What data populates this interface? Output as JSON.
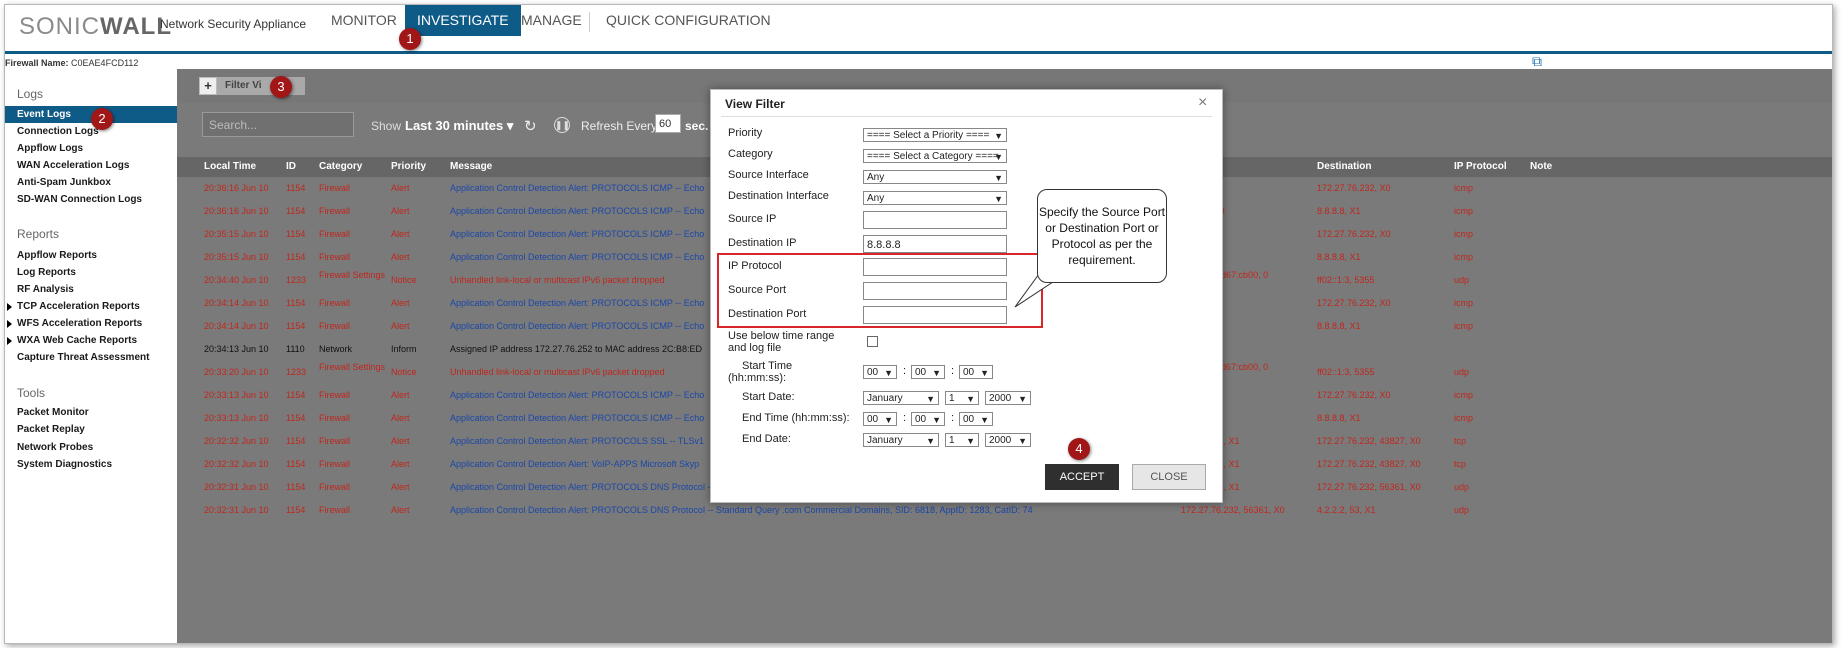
{
  "header": {
    "logo_light": "SONIC",
    "logo_bold": "WALL",
    "tagline": "Network Security Appliance",
    "tabs": [
      {
        "label": "MONITOR"
      },
      {
        "label": "INVESTIGATE"
      },
      {
        "label": "MANAGE"
      },
      {
        "label": "QUICK CONFIGURATION"
      }
    ],
    "firewall_label": "Firewall Name:",
    "firewall_value": "C0EAE4FCD112",
    "accent_color": "#0f5b87"
  },
  "sidebar": {
    "sections": [
      {
        "title": "Logs",
        "items": [
          "Event Logs",
          "Connection Logs",
          "Appflow Logs",
          "WAN Acceleration Logs",
          "Anti-Spam Junkbox",
          "SD-WAN Connection Logs"
        ]
      },
      {
        "title": "Reports",
        "items": [
          "Appflow Reports",
          "Log Reports",
          "RF Analysis",
          "TCP Acceleration Reports",
          "WFS Acceleration Reports",
          "WXA Web Cache Reports",
          "Capture Threat Assessment"
        ]
      },
      {
        "title": "Tools",
        "items": [
          "Packet Monitor",
          "Packet Replay",
          "Network Probes",
          "System Diagnostics"
        ]
      }
    ]
  },
  "toolbar": {
    "plus": "+",
    "filter_tab": "Filter Vi",
    "search_placeholder": "Search...",
    "show_label": "Show",
    "show_value": "Last 30 minutes ▾",
    "refresh_label": "Refresh Every",
    "refresh_value": "60",
    "refresh_unit": "sec."
  },
  "table": {
    "headers": [
      "Local Time",
      "ID",
      "Category",
      "Priority",
      "Message",
      "Destination",
      "IP Protocol",
      "Note"
    ],
    "rows": [
      {
        "time": "20:36:16 Jun 10",
        "id": "1154",
        "cat": "Firewall",
        "pri": "Alert",
        "msg": "Application Control Detection Alert: PROTOCOLS ICMP -- Echo",
        "src": "X1",
        "dst": "172.27.76.232, X0",
        "proto": "icmp",
        "color": "red"
      },
      {
        "time": "20:36:16 Jun 10",
        "id": "1154",
        "cat": "Firewall",
        "pri": "Alert",
        "msg": "Application Control Detection Alert: PROTOCOLS ICMP -- Echo",
        "src": "76.232, X0",
        "dst": "8.8.8.8, X1",
        "proto": "icmp",
        "color": "red"
      },
      {
        "time": "20:35:15 Jun 10",
        "id": "1154",
        "cat": "Firewall",
        "pri": "Alert",
        "msg": "Application Control Detection Alert: PROTOCOLS ICMP -- Echo",
        "src": "X1",
        "dst": "172.27.76.232, X0",
        "proto": "icmp",
        "color": "red"
      },
      {
        "time": "20:35:15 Jun 10",
        "id": "1154",
        "cat": "Firewall",
        "pri": "Alert",
        "msg": "Application Control Detection Alert: PROTOCOLS ICMP -- Echo",
        "src": "6.232, X0",
        "dst": "8.8.8.8, X1",
        "proto": "icmp",
        "color": "red"
      },
      {
        "time": "20:34:40 Jun 10",
        "id": "1233",
        "cat": "Firewall Settings",
        "pri": "Notice",
        "msg": "Unhandled link-local or multicast IPv6 packet dropped",
        "src": "88:3515:6d67:cb00, 0",
        "dst": "ff02::1:3, 5355",
        "proto": "udp",
        "color": "red"
      },
      {
        "time": "20:34:14 Jun 10",
        "id": "1154",
        "cat": "Firewall",
        "pri": "Alert",
        "msg": "Application Control Detection Alert: PROTOCOLS ICMP -- Echo",
        "src": "X1",
        "dst": "172.27.76.232, X0",
        "proto": "icmp",
        "color": "red"
      },
      {
        "time": "20:34:14 Jun 10",
        "id": "1154",
        "cat": "Firewall",
        "pri": "Alert",
        "msg": "Application Control Detection Alert: PROTOCOLS ICMP -- Echo",
        "src": "6.232, X0",
        "dst": "8.8.8.8, X1",
        "proto": "icmp",
        "color": "red"
      },
      {
        "time": "20:34:13 Jun 10",
        "id": "1110",
        "cat": "Network",
        "pri": "Inform",
        "msg": "Assigned IP address 172.27.76.252 to MAC address 2C:B8:ED",
        "src": "",
        "dst": "",
        "proto": "",
        "color": "dark"
      },
      {
        "time": "20:33:20 Jun 10",
        "id": "1233",
        "cat": "Firewall Settings",
        "pri": "Notice",
        "msg": "Unhandled link-local or multicast IPv6 packet dropped",
        "src": "88:3515:6d67:cb00, 0",
        "dst": "ff02::1:3, 5355",
        "proto": "udp",
        "color": "red"
      },
      {
        "time": "20:33:13 Jun 10",
        "id": "1154",
        "cat": "Firewall",
        "pri": "Alert",
        "msg": "Application Control Detection Alert: PROTOCOLS ICMP -- Echo",
        "src": "X1",
        "dst": "172.27.76.232, X0",
        "proto": "icmp",
        "color": "red"
      },
      {
        "time": "20:33:13 Jun 10",
        "id": "1154",
        "cat": "Firewall",
        "pri": "Alert",
        "msg": "Application Control Detection Alert: PROTOCOLS ICMP -- Echo",
        "src": "6.232, X0",
        "dst": "8.8.8.8, X1",
        "proto": "icmp",
        "color": "red"
      },
      {
        "time": "20:32:32 Jun 10",
        "id": "1154",
        "cat": "Firewall",
        "pri": "Alert",
        "msg": "Application Control Detection Alert: PROTOCOLS SSL -- TLSv1",
        "src": "58.53, 443, X1",
        "dst": "172.27.76.232, 43827, X0",
        "proto": "tcp",
        "color": "red"
      },
      {
        "time": "20:32:32 Jun 10",
        "id": "1154",
        "cat": "Firewall",
        "pri": "Alert",
        "msg": "Application Control Detection Alert: VoIP-APPS Microsoft Skyp",
        "src": "58.53, 443, X1",
        "dst": "172.27.76.232, 43827, X0",
        "proto": "tcp",
        "color": "red"
      },
      {
        "time": "20:32:31 Jun 10",
        "id": "1154",
        "cat": "Firewall",
        "pri": "Alert",
        "msg": "Application Control Detection Alert: PROTOCOLS DNS Protocol -- Standard Query Response (Non-Authoritative), SID: 4398, AppID: 1283, CatID: 74",
        "src": "4.2.2.2, 53, X1",
        "dst": "172.27.76.232, 56361, X0",
        "proto": "udp",
        "color": "red"
      },
      {
        "time": "20:32:31 Jun 10",
        "id": "1154",
        "cat": "Firewall",
        "pri": "Alert",
        "msg": "Application Control Detection Alert: PROTOCOLS DNS Protocol -- Standard Query .com Commercial Domains, SID: 6818, AppID: 1283, CatID: 74",
        "src": "172.27.76.232, 56361, X0",
        "dst": "4.2.2.2, 53, X1",
        "proto": "udp",
        "color": "red"
      }
    ]
  },
  "modal": {
    "title": "View Filter",
    "close": "×",
    "priority_label": "Priority",
    "priority_value": "==== Select a Priority ====",
    "category_label": "Category",
    "category_value": "==== Select a Category ====",
    "src_iface_label": "Source Interface",
    "src_iface_value": "Any",
    "dst_iface_label": "Destination Interface",
    "dst_iface_value": "Any",
    "src_ip_label": "Source IP",
    "src_ip_value": "",
    "dst_ip_label": "Destination IP",
    "dst_ip_value": "8.8.8.8",
    "ip_proto_label": "IP Protocol",
    "src_port_label": "Source Port",
    "dst_port_label": "Destination Port",
    "use_time_label_1": "Use below time range",
    "use_time_label_2": "and log file",
    "start_time_label_1": "Start Time",
    "start_time_label_2": "(hh:mm:ss):",
    "start_date_label": "Start Date:",
    "end_time_label": "End Time (hh:mm:ss):",
    "end_date_label": "End Date:",
    "time_hh": "00",
    "time_mm": "00",
    "time_ss": "00",
    "month": "January",
    "day": "1",
    "year": "2000",
    "colon": ":",
    "accept": "ACCEPT",
    "close_btn": "CLOSE"
  },
  "annotations": {
    "callout": "Specify the Source Port or Destination Port or Protocol as per the requirement.",
    "badges": [
      "1",
      "2",
      "3",
      "4"
    ],
    "badge_color": "#a11616"
  }
}
